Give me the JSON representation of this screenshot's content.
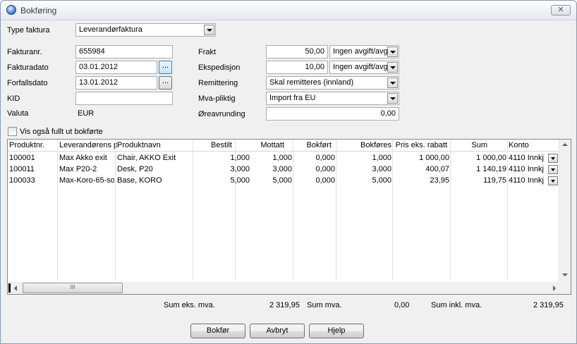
{
  "window": {
    "title": "Bokføring"
  },
  "form": {
    "type_label": "Type faktura",
    "type_value": "Leverandørfaktura",
    "invoice_no_label": "Fakturanr.",
    "invoice_no": "655984",
    "invoice_date_label": "Fakturadato",
    "invoice_date": "03.01.2012",
    "due_date_label": "Forfallsdato",
    "due_date": "13.01.2012",
    "kid_label": "KID",
    "kid": "",
    "currency_label": "Valuta",
    "currency": "EUR",
    "freight_label": "Frakt",
    "freight": "50,00",
    "freight_vat": "Ingen avgift/avg",
    "expedition_label": "Ekspedisjon",
    "expedition": "10,00",
    "expedition_vat": "Ingen avgift/avg",
    "remit_label": "Remittering",
    "remit_value": "Skal remitteres (innland)",
    "vat_label": "Mva-pliktig",
    "vat_value": "Import fra EU",
    "rounding_label": "Øreavrunding",
    "rounding": "0,00",
    "show_all_label": "Vis også fullt ut bokførte",
    "cal_btn_label": "...",
    "dots_btn_label": "..."
  },
  "grid": {
    "columns": [
      "Produktnr.",
      "Leverandørens p",
      "Produktnavn",
      "Bestilt",
      "Mottatt",
      "Bokført",
      "Bokføres",
      "Pris eks. rabatt",
      "Sum",
      "Konto"
    ],
    "rows": [
      [
        "100001",
        "Max Akko exit",
        "Chair, AKKO Exit",
        "1,000",
        "1,000",
        "0,000",
        "1,000",
        "1 000,00",
        "1 000,00",
        "4110 Innkj"
      ],
      [
        "100011",
        "Max P20-2",
        "Desk, P20",
        "3,000",
        "3,000",
        "0,000",
        "3,000",
        "400,07",
        "1 140,19",
        "4110 Innkj"
      ],
      [
        "100033",
        "Max-Koro-65-so",
        "Base, KORO",
        "5,000",
        "5,000",
        "0,000",
        "5,000",
        "23,95",
        "119,75",
        "4110 Innkj"
      ]
    ],
    "hscroll_grip": "III"
  },
  "totals": {
    "ex_vat_label": "Sum eks. mva.",
    "ex_vat": "2 319,95",
    "vat_label": "Sum mva.",
    "vat": "0,00",
    "inc_vat_label": "Sum inkl. mva.",
    "inc_vat": "2 319,95"
  },
  "buttons": {
    "post": "Bokfør",
    "cancel": "Avbryt",
    "help": "Hjelp"
  },
  "icons": {
    "close": "close-icon",
    "app": "app-icon"
  }
}
